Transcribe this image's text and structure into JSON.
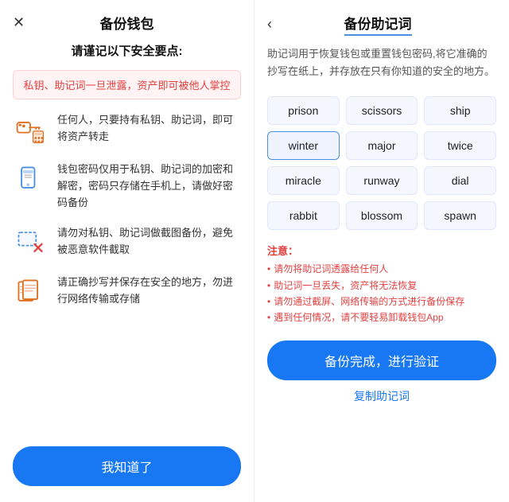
{
  "left": {
    "title": "备份钱包",
    "close_label": "✕",
    "security_title": "请谨记以下安全要点:",
    "warning_banner": "私钥、助记词一旦泄露，资产即可被他人掌控",
    "items": [
      {
        "id": "key",
        "text": "任何人，只要持有私钥、助记词，即可将资产转走"
      },
      {
        "id": "phone",
        "text": "钱包密码仅用于私钥、助记词的加密和解密，密码只存储在手机上，请做好密码备份"
      },
      {
        "id": "screenshot",
        "text": "请勿对私钥、助记词做截图备份，避免被恶意软件截取"
      },
      {
        "id": "copy",
        "text": "请正确抄写并保存在安全的地方，勿进行网络传输或存储"
      }
    ],
    "know_btn": "我知道了"
  },
  "right": {
    "back_label": "‹",
    "title": "备份助记词",
    "description": "助记词用于恢复钱包或重置钱包密码,将它准确的抄写在纸上，并存放在只有你知道的安全的地方。",
    "words": [
      "prison",
      "scissors",
      "ship",
      "winter",
      "major",
      "twice",
      "miracle",
      "runway",
      "dial",
      "rabbit",
      "blossom",
      "spawn"
    ],
    "highlight_index": 3,
    "notice": {
      "title": "注意：",
      "items": [
        "请勿将助记词透露给任何人",
        "助记词一旦丢失，资产将无法恢复",
        "请勿通过截屏、网络传输的方式进行备份保存",
        "遇到任何情况，请不要轻易卸载钱包App"
      ]
    },
    "backup_btn": "备份完成，进行验证",
    "copy_link": "复制助记词"
  }
}
